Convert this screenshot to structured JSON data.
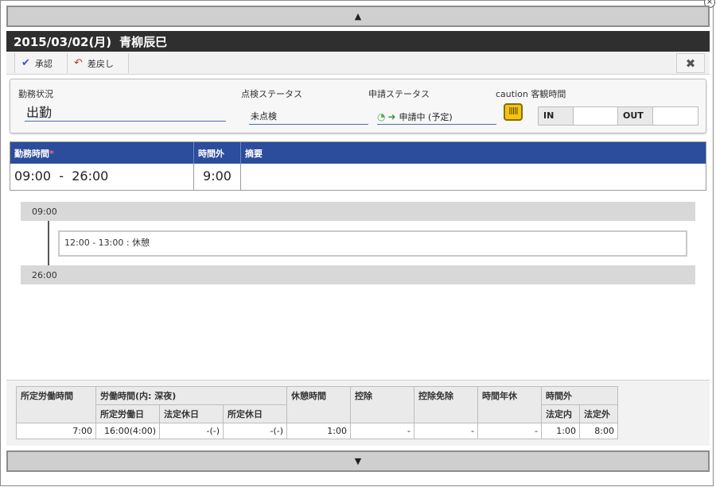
{
  "nav": {
    "up_arrow": "▲",
    "down_arrow": "▼"
  },
  "header": {
    "date": "2015/03/02(月)",
    "name": "青柳辰巳"
  },
  "toolbar": {
    "approve_label": "承認",
    "reject_label": "差戻し",
    "close_glyph": "✖"
  },
  "status": {
    "attendance_label": "勤務状況",
    "attendance_value": "出勤",
    "inspection_label": "点検ステータス",
    "inspection_value": "未点検",
    "application_label": "申請ステータス",
    "application_value": "申請中 (予定)",
    "objective_label": "caution 客観時間",
    "in_label": "IN",
    "in_value": "",
    "out_label": "OUT",
    "out_value": ""
  },
  "work_table": {
    "headers": {
      "work_time": "勤務時間",
      "required_mark": "*",
      "overtime": "時間外",
      "summary": "摘要"
    },
    "row": {
      "work_time": "09:00  -  26:00",
      "overtime": "9:00",
      "summary": ""
    }
  },
  "timeline": {
    "start": "09:00",
    "end": "26:00",
    "items": [
      {
        "label": "12:00 - 13:00 : 休憩"
      }
    ]
  },
  "summary": {
    "headers": {
      "scheduled_hours": "所定労働時間",
      "work_hours": "労働時間(内: 深夜)",
      "break_hours": "休憩時間",
      "deduction": "控除",
      "deduction_exempt": "控除免除",
      "hourly_leave": "時間年休",
      "overtime": "時間外",
      "scheduled_workday": "所定労働日",
      "legal_holiday": "法定休日",
      "scheduled_holiday": "所定休日",
      "legal_within": "法定内",
      "legal_outside": "法定外"
    },
    "values": {
      "scheduled_hours": "7:00",
      "scheduled_workday": "16:00(4:00)",
      "legal_holiday": "-(-)",
      "scheduled_holiday": "-(-)",
      "break_hours": "1:00",
      "deduction": "-",
      "deduction_exempt": "-",
      "hourly_leave": "-",
      "legal_within": "1:00",
      "legal_outside": "8:00"
    }
  }
}
